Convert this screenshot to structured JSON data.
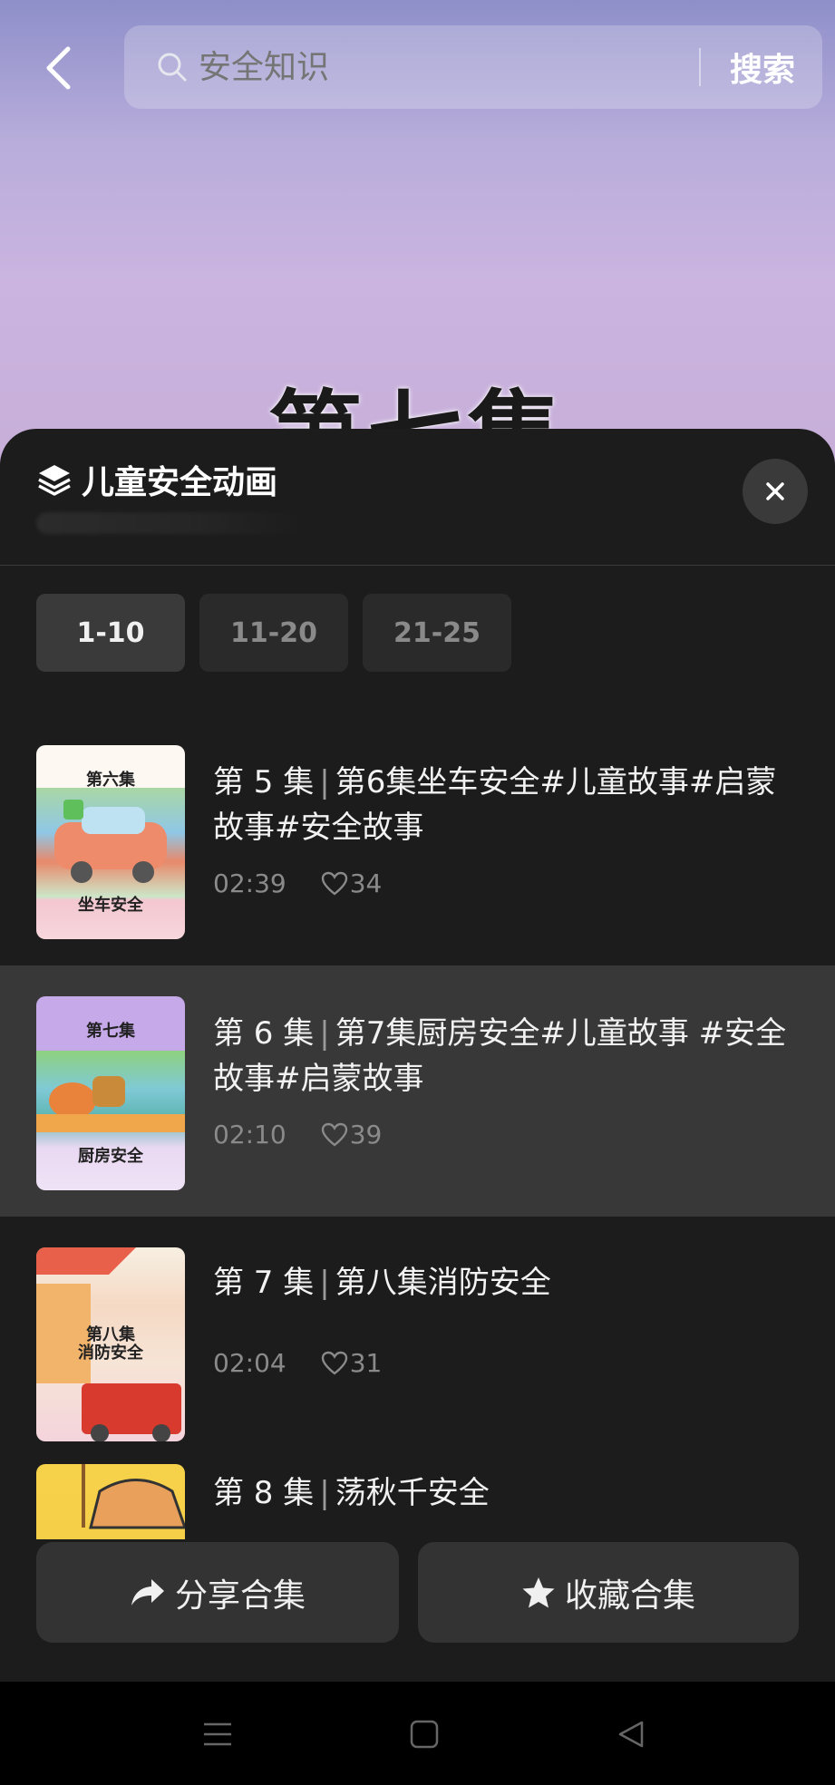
{
  "top_bar": {
    "search_placeholder": "安全知识",
    "search_button": "搜索"
  },
  "video": {
    "overlay_title": "第七集"
  },
  "sheet": {
    "title": "儿童安全动画",
    "range_tabs": [
      {
        "label": "1-10",
        "active": true
      },
      {
        "label": "11-20",
        "active": false
      },
      {
        "label": "21-25",
        "active": false
      }
    ],
    "episodes": [
      {
        "number_label": "第 5 集",
        "title": "第6集坐车安全#儿童故事#启蒙故事#安全故事",
        "duration": "02:39",
        "likes": "34",
        "thumb_top": "第六集",
        "thumb_bottom": "坐车安全",
        "selected": false
      },
      {
        "number_label": "第 6 集",
        "title": "第7集厨房安全#儿童故事 #安全故事#启蒙故事",
        "duration": "02:10",
        "likes": "39",
        "thumb_top": "第七集",
        "thumb_bottom": "厨房安全",
        "selected": true
      },
      {
        "number_label": "第 7 集",
        "title": "第八集消防安全",
        "duration": "02:04",
        "likes": "31",
        "thumb_top": "第八集",
        "thumb_bottom": "消防安全",
        "selected": false
      },
      {
        "number_label": "第 8 集",
        "title": "荡秋千安全",
        "selected": false
      }
    ],
    "share_label": "分享合集",
    "favorite_label": "收藏合集"
  },
  "colors": {
    "sheet_bg": "#1c1c1c",
    "selected_row": "#383838",
    "button_bg": "#333333"
  }
}
